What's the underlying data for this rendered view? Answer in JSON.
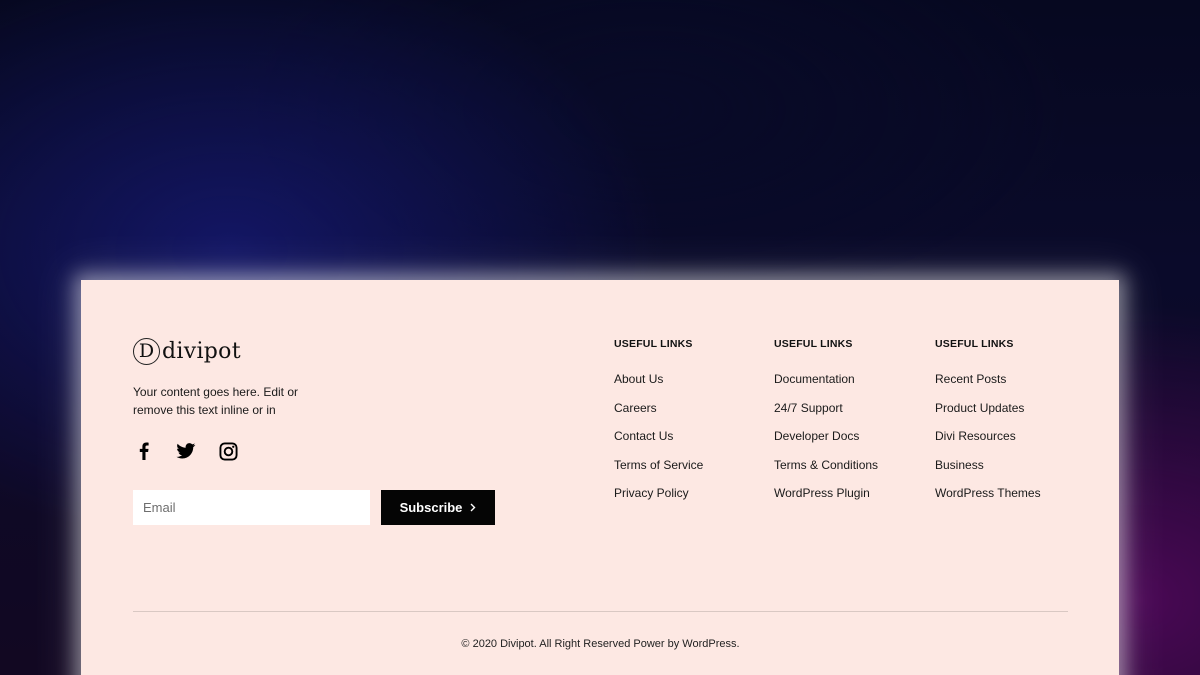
{
  "brand": {
    "logo_mark": "D",
    "name": "divipot",
    "description": "Your content goes here. Edit or remove this text inline or in"
  },
  "socials": [
    {
      "name": "facebook-icon"
    },
    {
      "name": "twitter-icon"
    },
    {
      "name": "instagram-icon"
    }
  ],
  "subscribe": {
    "email_placeholder": "Email",
    "email_value": "",
    "button_label": "Subscribe",
    "button_icon": "chevron-right-icon"
  },
  "columns": [
    {
      "heading": "USEFUL LINKS",
      "links": [
        "About Us",
        "Careers",
        "Contact Us",
        "Terms of Service",
        "Privacy Policy"
      ]
    },
    {
      "heading": "USEFUL LINKS",
      "links": [
        "Documentation",
        "24/7 Support",
        "Developer Docs",
        "Terms & Conditions",
        "WordPress Plugin"
      ]
    },
    {
      "heading": "USEFUL LINKS",
      "links": [
        "Recent Posts",
        "Product Updates",
        "Divi Resources",
        "Business",
        "WordPress Themes"
      ]
    }
  ],
  "copyright": "© 2020 Divipot. All Right Reserved Power by WordPress.",
  "colors": {
    "card_background": "#fde8e3",
    "button_background": "#050505",
    "text": "#1a1a1a"
  }
}
